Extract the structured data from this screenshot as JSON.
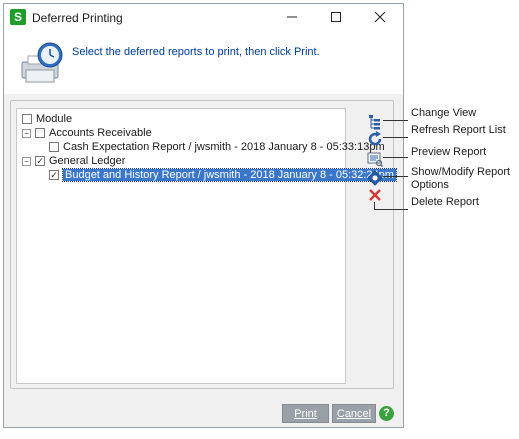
{
  "window": {
    "title": "Deferred Printing"
  },
  "instructions": "Select the deferred reports to print, then click Print.",
  "tree": {
    "root": "Module",
    "groups": [
      {
        "label": "Accounts Receivable",
        "expanded": true,
        "checked": false,
        "items": [
          {
            "label": "Cash Expectation Report  /  jwsmith - 2018 January 8 - 05:33:13pm",
            "checked": false,
            "selected": false
          }
        ]
      },
      {
        "label": "General Ledger",
        "expanded": true,
        "checked": true,
        "items": [
          {
            "label": "Budget and History Report  /  jwsmith - 2018 January 8 - 05:32:24pm",
            "checked": true,
            "selected": true
          }
        ]
      }
    ]
  },
  "toolbar": {
    "change_view": "Change View",
    "refresh": "Refresh Report List",
    "preview": "Preview Report",
    "options_line1": "Show/Modify Report",
    "options_line2": "Options",
    "delete": "Delete Report"
  },
  "buttons": {
    "print": "Print",
    "cancel": "Cancel",
    "help": "?"
  },
  "colors": {
    "selection": "#3a77c9",
    "app_icon": "#1e9d2a",
    "help": "#3aa141",
    "delete_icon": "#d23b3b"
  }
}
